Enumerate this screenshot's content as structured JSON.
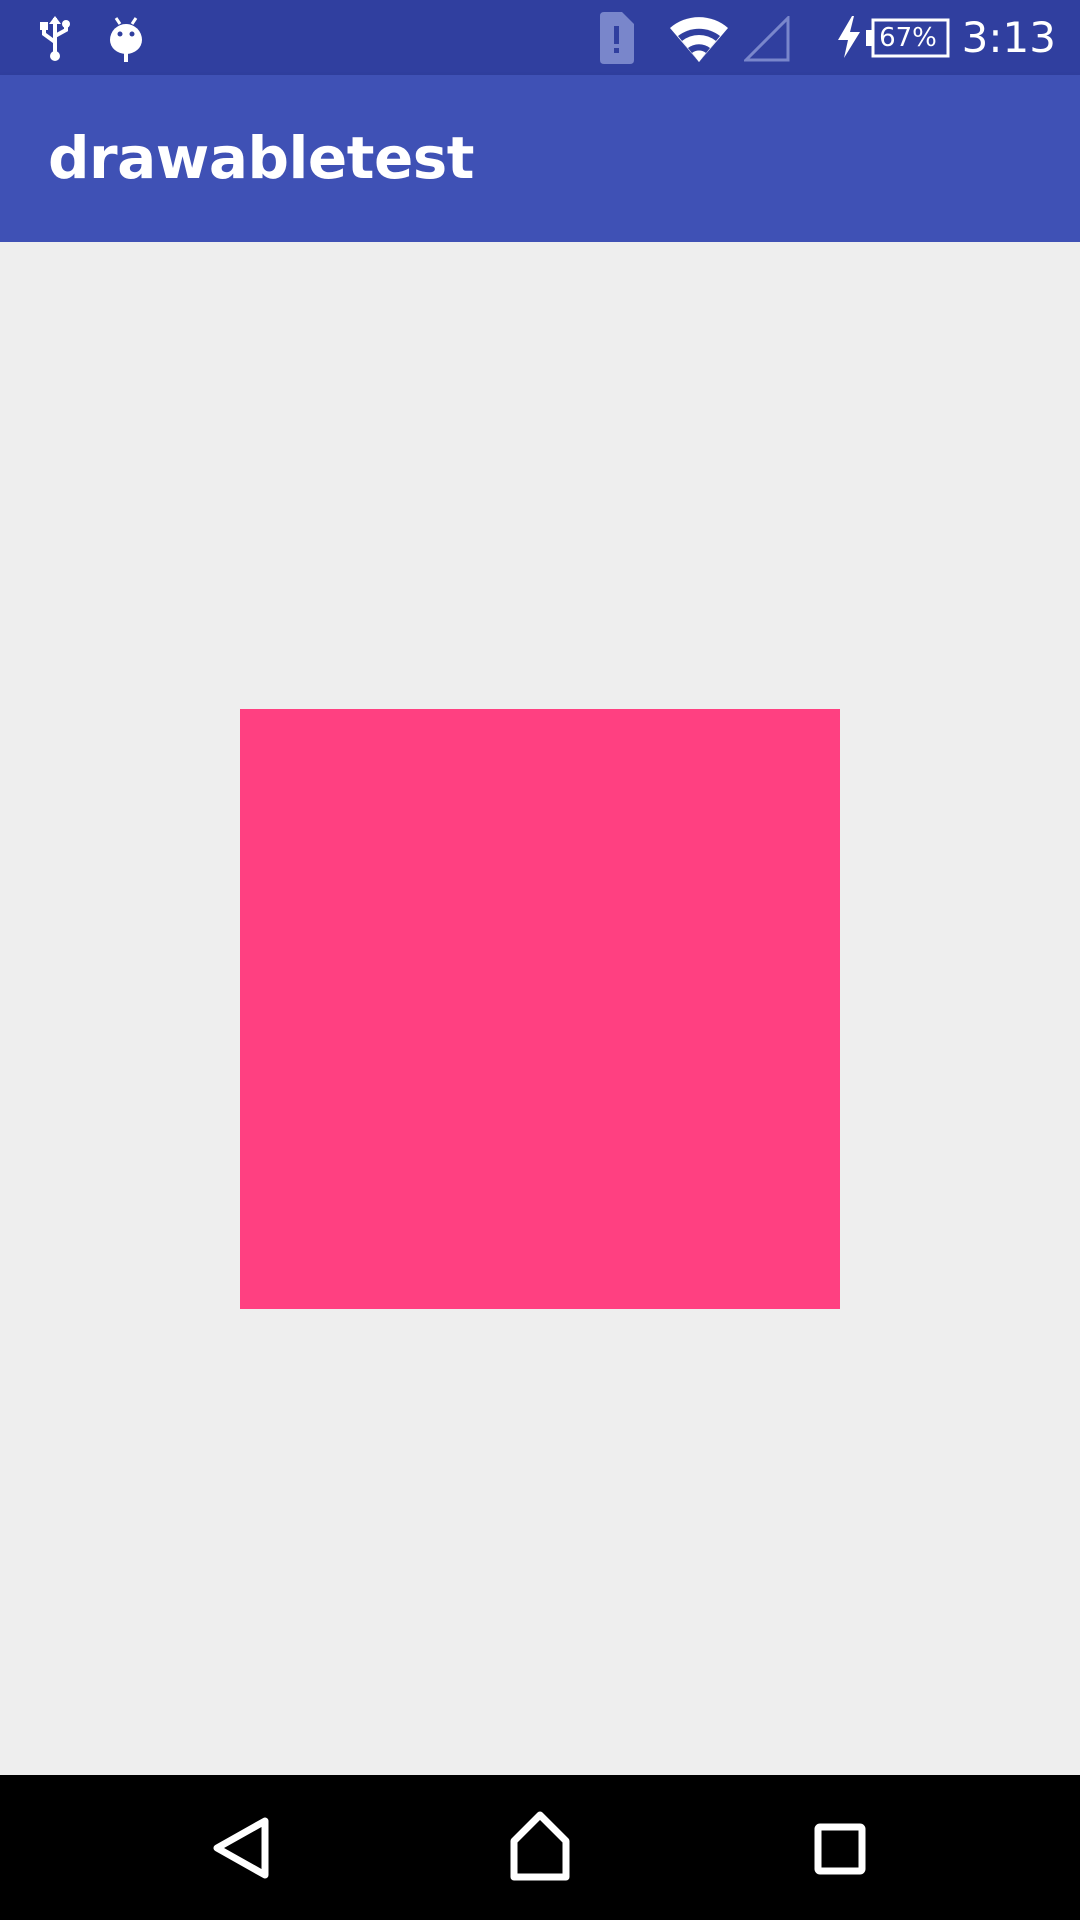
{
  "status_bar": {
    "background": "#303f9f",
    "icons_left": [
      "usb-icon",
      "android-debug-icon"
    ],
    "icons_right": [
      "sim-alert-icon",
      "wifi-icon",
      "cell-signal-icon",
      "charging-bolt-icon",
      "battery-icon"
    ],
    "battery_percent": "67%",
    "time": "3:13"
  },
  "app_bar": {
    "background": "#3f51b5",
    "title": "drawabletest"
  },
  "content": {
    "background": "#eeeeee",
    "drawable_color": "#ff4081"
  },
  "nav_bar": {
    "background": "#000000",
    "buttons": [
      "back-icon",
      "home-icon",
      "recents-icon"
    ]
  }
}
